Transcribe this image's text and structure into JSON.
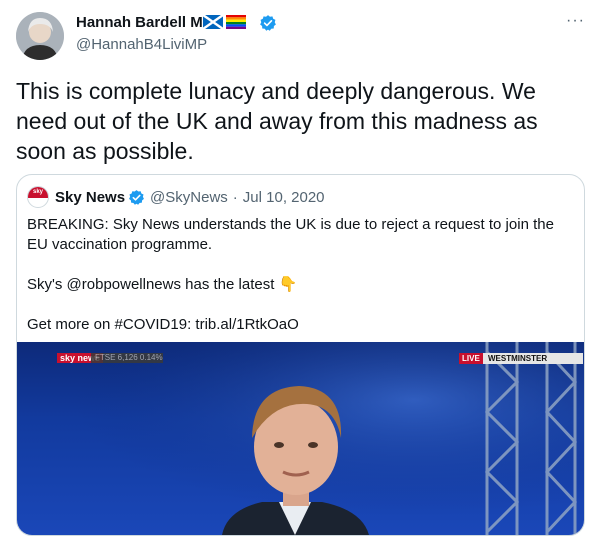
{
  "author": {
    "name": "Hannah Bardell MP",
    "handle": "@HannahB4LiviMP",
    "flags": [
      "scotland-flag-icon",
      "rainbow-flag-icon"
    ]
  },
  "more_label": "···",
  "tweet": {
    "text": "This is complete lunacy and deeply dangerous. We need out of the UK and away from this madness as soon as possible."
  },
  "quoted": {
    "logo_text": "sky",
    "name": "Sky News",
    "handle": "@SkyNews",
    "separator": "·",
    "date": "Jul 10, 2020",
    "lines": [
      "BREAKING: Sky News understands the UK is due to reject a request to join the EU vaccination programme.",
      "Sky's @robpowellnews has the latest 👇",
      "Get more on #COVID19: trib.al/1RtkOaO"
    ],
    "video": {
      "brand": "sky news",
      "ticker": "FTSE 6,126  0.14%",
      "live": "LIVE",
      "location": "WESTMINSTER"
    }
  },
  "colors": {
    "verified": "#1d9bf0",
    "text": "#0f1419",
    "secondary": "#536471",
    "border": "#cfd9de",
    "sky_red": "#c8102e"
  }
}
